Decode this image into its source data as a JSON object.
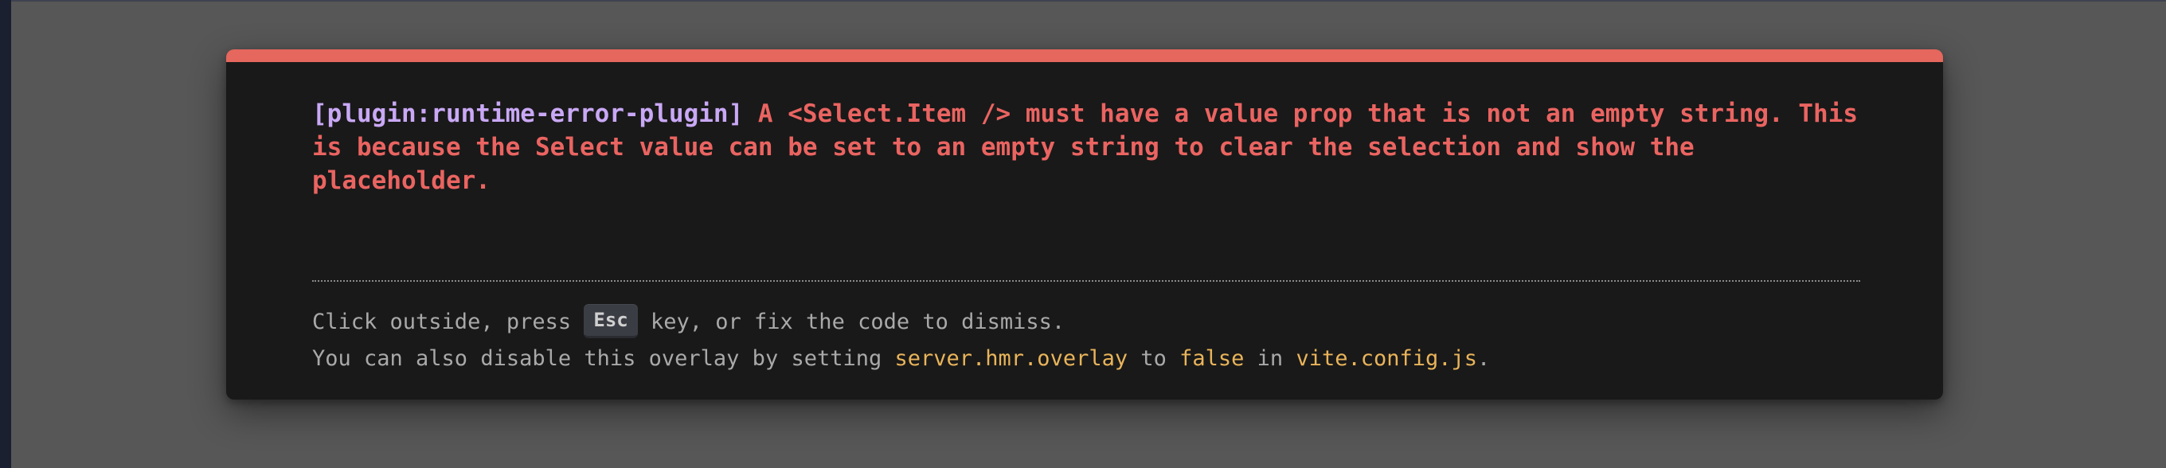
{
  "overlay": {
    "plugin_tag": "[plugin:runtime-error-plugin]",
    "message": "A <Select.Item /> must have a value prop that is not an empty string. This is because the Select value can be set to an empty string to clear the selection and show the placeholder.",
    "tip": {
      "before_key": "Click outside, press ",
      "key": "Esc",
      "after_key": " key, or fix the code to dismiss."
    },
    "tip2": {
      "part1": "You can also disable this overlay by setting ",
      "setting": "server.hmr.overlay",
      "part2": " to ",
      "value": "false",
      "part3": " in ",
      "file": "vite.config.js",
      "part4": "."
    }
  },
  "colors": {
    "accent_bar": "#e5675d",
    "error_text": "#ea6461",
    "plugin_text": "#c9a8f6",
    "code_text": "#e9b45a",
    "panel_bg": "#191919",
    "backdrop": "#575757"
  }
}
